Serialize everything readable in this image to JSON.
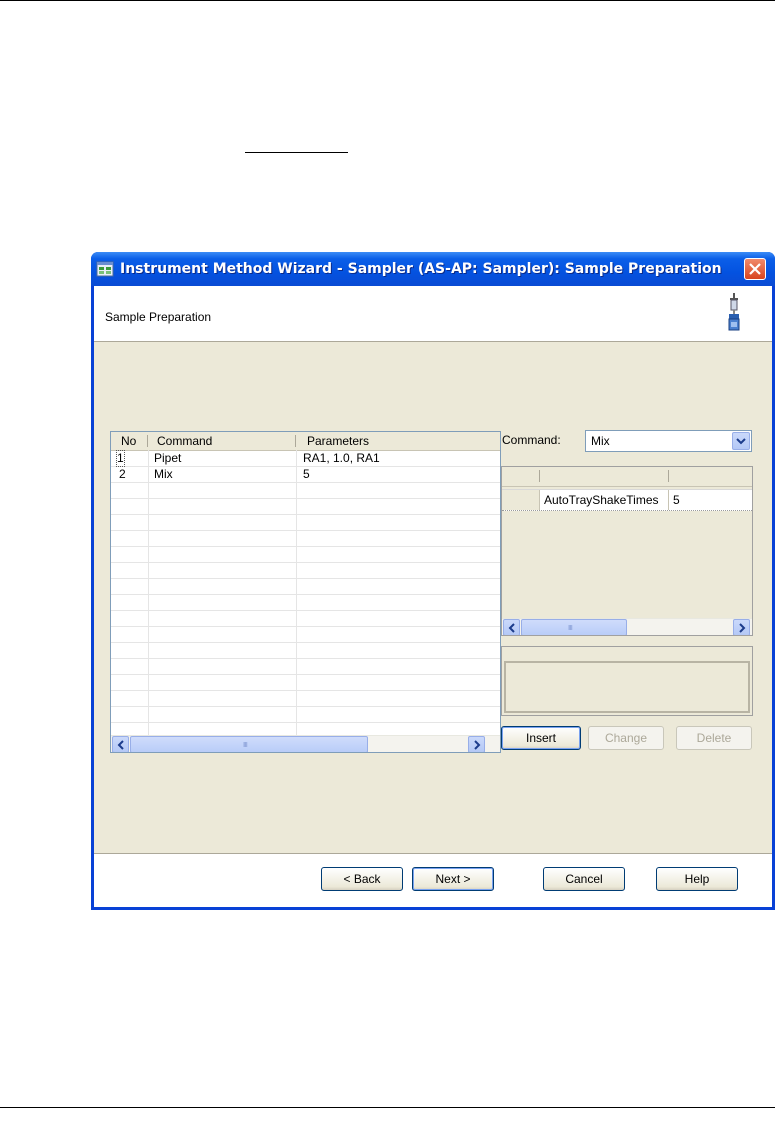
{
  "window": {
    "title": "Instrument Method Wizard - Sampler (AS-AP: Sampler): Sample Preparation",
    "header_title": "Sample Preparation"
  },
  "command_grid": {
    "columns": [
      "No",
      "Command",
      "Parameters"
    ],
    "rows": [
      {
        "no": "1",
        "command": "Pipet",
        "parameters": "RA1, 1.0, RA1"
      },
      {
        "no": "2",
        "command": "Mix",
        "parameters": "5"
      }
    ],
    "scroll_grip": "IIII"
  },
  "command_field": {
    "label": "Command:",
    "value": "Mix"
  },
  "parameters_grid": {
    "rows": [
      {
        "name": "AutoTrayShakeTimes",
        "value": "5"
      }
    ],
    "scroll_grip": "IIII"
  },
  "buttons": {
    "insert": "Insert",
    "change": "Change",
    "delete": "Delete",
    "back": "< Back",
    "next": "Next >",
    "cancel": "Cancel",
    "help": "Help"
  },
  "colors": {
    "titlebar": "#0452e0",
    "close": "#d8441f",
    "dialog_bg": "#ece9d8"
  },
  "icons": [
    "app-icon",
    "close-icon",
    "syringe-icon",
    "left-arrow-icon",
    "right-arrow-icon",
    "dropdown-arrow-icon"
  ]
}
